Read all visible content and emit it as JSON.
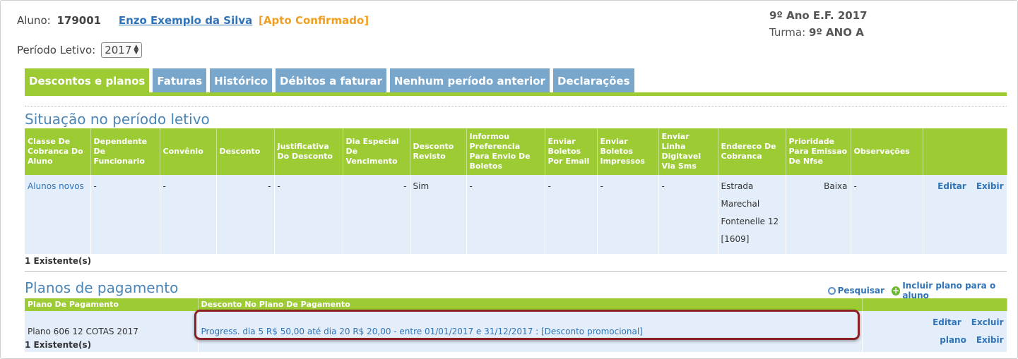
{
  "header": {
    "aluno_label": "Aluno:",
    "aluno_id": "179001",
    "aluno_name": "Enzo Exemplo da Silva",
    "aluno_status": "[Apto Confirmado]",
    "serie": "9º Ano E.F. 2017",
    "turma_label": "Turma:",
    "turma_value": "9º ANO A",
    "periodo_label": "Período Letivo:",
    "periodo_value": "2017"
  },
  "tabs": [
    {
      "label": "Descontos e planos",
      "active": true
    },
    {
      "label": "Faturas"
    },
    {
      "label": "Histórico"
    },
    {
      "label": "Débitos a faturar"
    },
    {
      "label": "Nenhum período anterior"
    },
    {
      "label": "Declarações"
    }
  ],
  "situacao": {
    "title": "Situação no período letivo",
    "headers": [
      "Classe De Cobranca Do Aluno",
      "Dependente De Funcionario",
      "Convênio",
      "Desconto",
      "Justificativa Do Desconto",
      "Dia Especial De Vencimento",
      "Desconto Revisto",
      "Informou Preferencia Para Envio De Boletos",
      "Enviar Boletos Por Email",
      "Enviar Boletos Impressos",
      "Enviar Linha Digitavel Via Sms",
      "Endereco De Cobranca",
      "Prioridade Para Emissao De Nfse",
      "Observações",
      ""
    ],
    "row": {
      "classe": "Alunos novos",
      "dependente": "-",
      "convenio": "-",
      "desconto": "-",
      "justificativa": "-",
      "dia_especial": "-",
      "desconto_revisto": "Sim",
      "informou": "-",
      "email": "-",
      "impressos": "-",
      "sms": "-",
      "endereco": "Estrada Marechal Fontenelle 12 [1609]",
      "prioridade": "Baixa",
      "observacoes": "-",
      "edit_label": "Editar",
      "view_label": "Exibir"
    },
    "count": "1 Existente(s)"
  },
  "planos": {
    "title": "Planos de pagamento",
    "search_label": "Pesquisar",
    "add_label": "Incluir plano para o aluno",
    "headers": [
      "Plano De Pagamento",
      "Desconto No Plano De Pagamento",
      ""
    ],
    "row": {
      "plano": "Plano 606 12 COTAS 2017",
      "desconto": "Progress. dia 5 R$ 50,00 até dia 20 R$ 20,00 - entre 01/01/2017 e 31/12/2017 : [Desconto promocional]",
      "edit_label": "Editar",
      "delete_label": "Excluir plano",
      "view_label": "Exibir"
    },
    "count": "1 Existente(s)"
  },
  "colors": {
    "green": "#9ccb33",
    "blue_tab": "#79a6cb",
    "link": "#2f73b8",
    "status": "#f0a020",
    "highlight": "#8a1f24"
  }
}
